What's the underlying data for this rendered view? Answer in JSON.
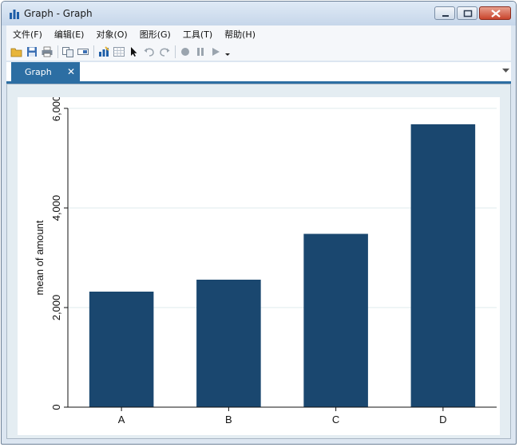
{
  "window": {
    "title": "Graph - Graph"
  },
  "menu": {
    "items": [
      "文件(F)",
      "编辑(E)",
      "对象(O)",
      "图形(G)",
      "工具(T)",
      "帮助(H)"
    ]
  },
  "toolbar": {
    "buttons": [
      "open-icon",
      "save-icon",
      "print-icon",
      "copy-icon",
      "rename-icon",
      "graph-editor-icon",
      "data-editor-icon",
      "pointer-icon",
      "undo-icon",
      "redo-icon",
      "record-icon",
      "pause-icon",
      "play-icon"
    ]
  },
  "tabs": [
    {
      "label": "Graph",
      "close": "✕"
    }
  ],
  "colors": {
    "bar": "#1a476f",
    "tab": "#2c6ea3",
    "plot_background": "#e4edf2",
    "gridline": "#eaf2f3"
  },
  "chart_data": {
    "type": "bar",
    "categories": [
      "A",
      "B",
      "C",
      "D"
    ],
    "values": [
      2320,
      2560,
      3480,
      5680
    ],
    "ylabel": "mean of amount",
    "xlabel": "",
    "ylim": [
      0,
      6000
    ],
    "yticks": [
      0,
      2000,
      4000,
      6000
    ],
    "ytick_labels": [
      "0",
      "2,000",
      "4,000",
      "6,000"
    ],
    "grid": true
  }
}
